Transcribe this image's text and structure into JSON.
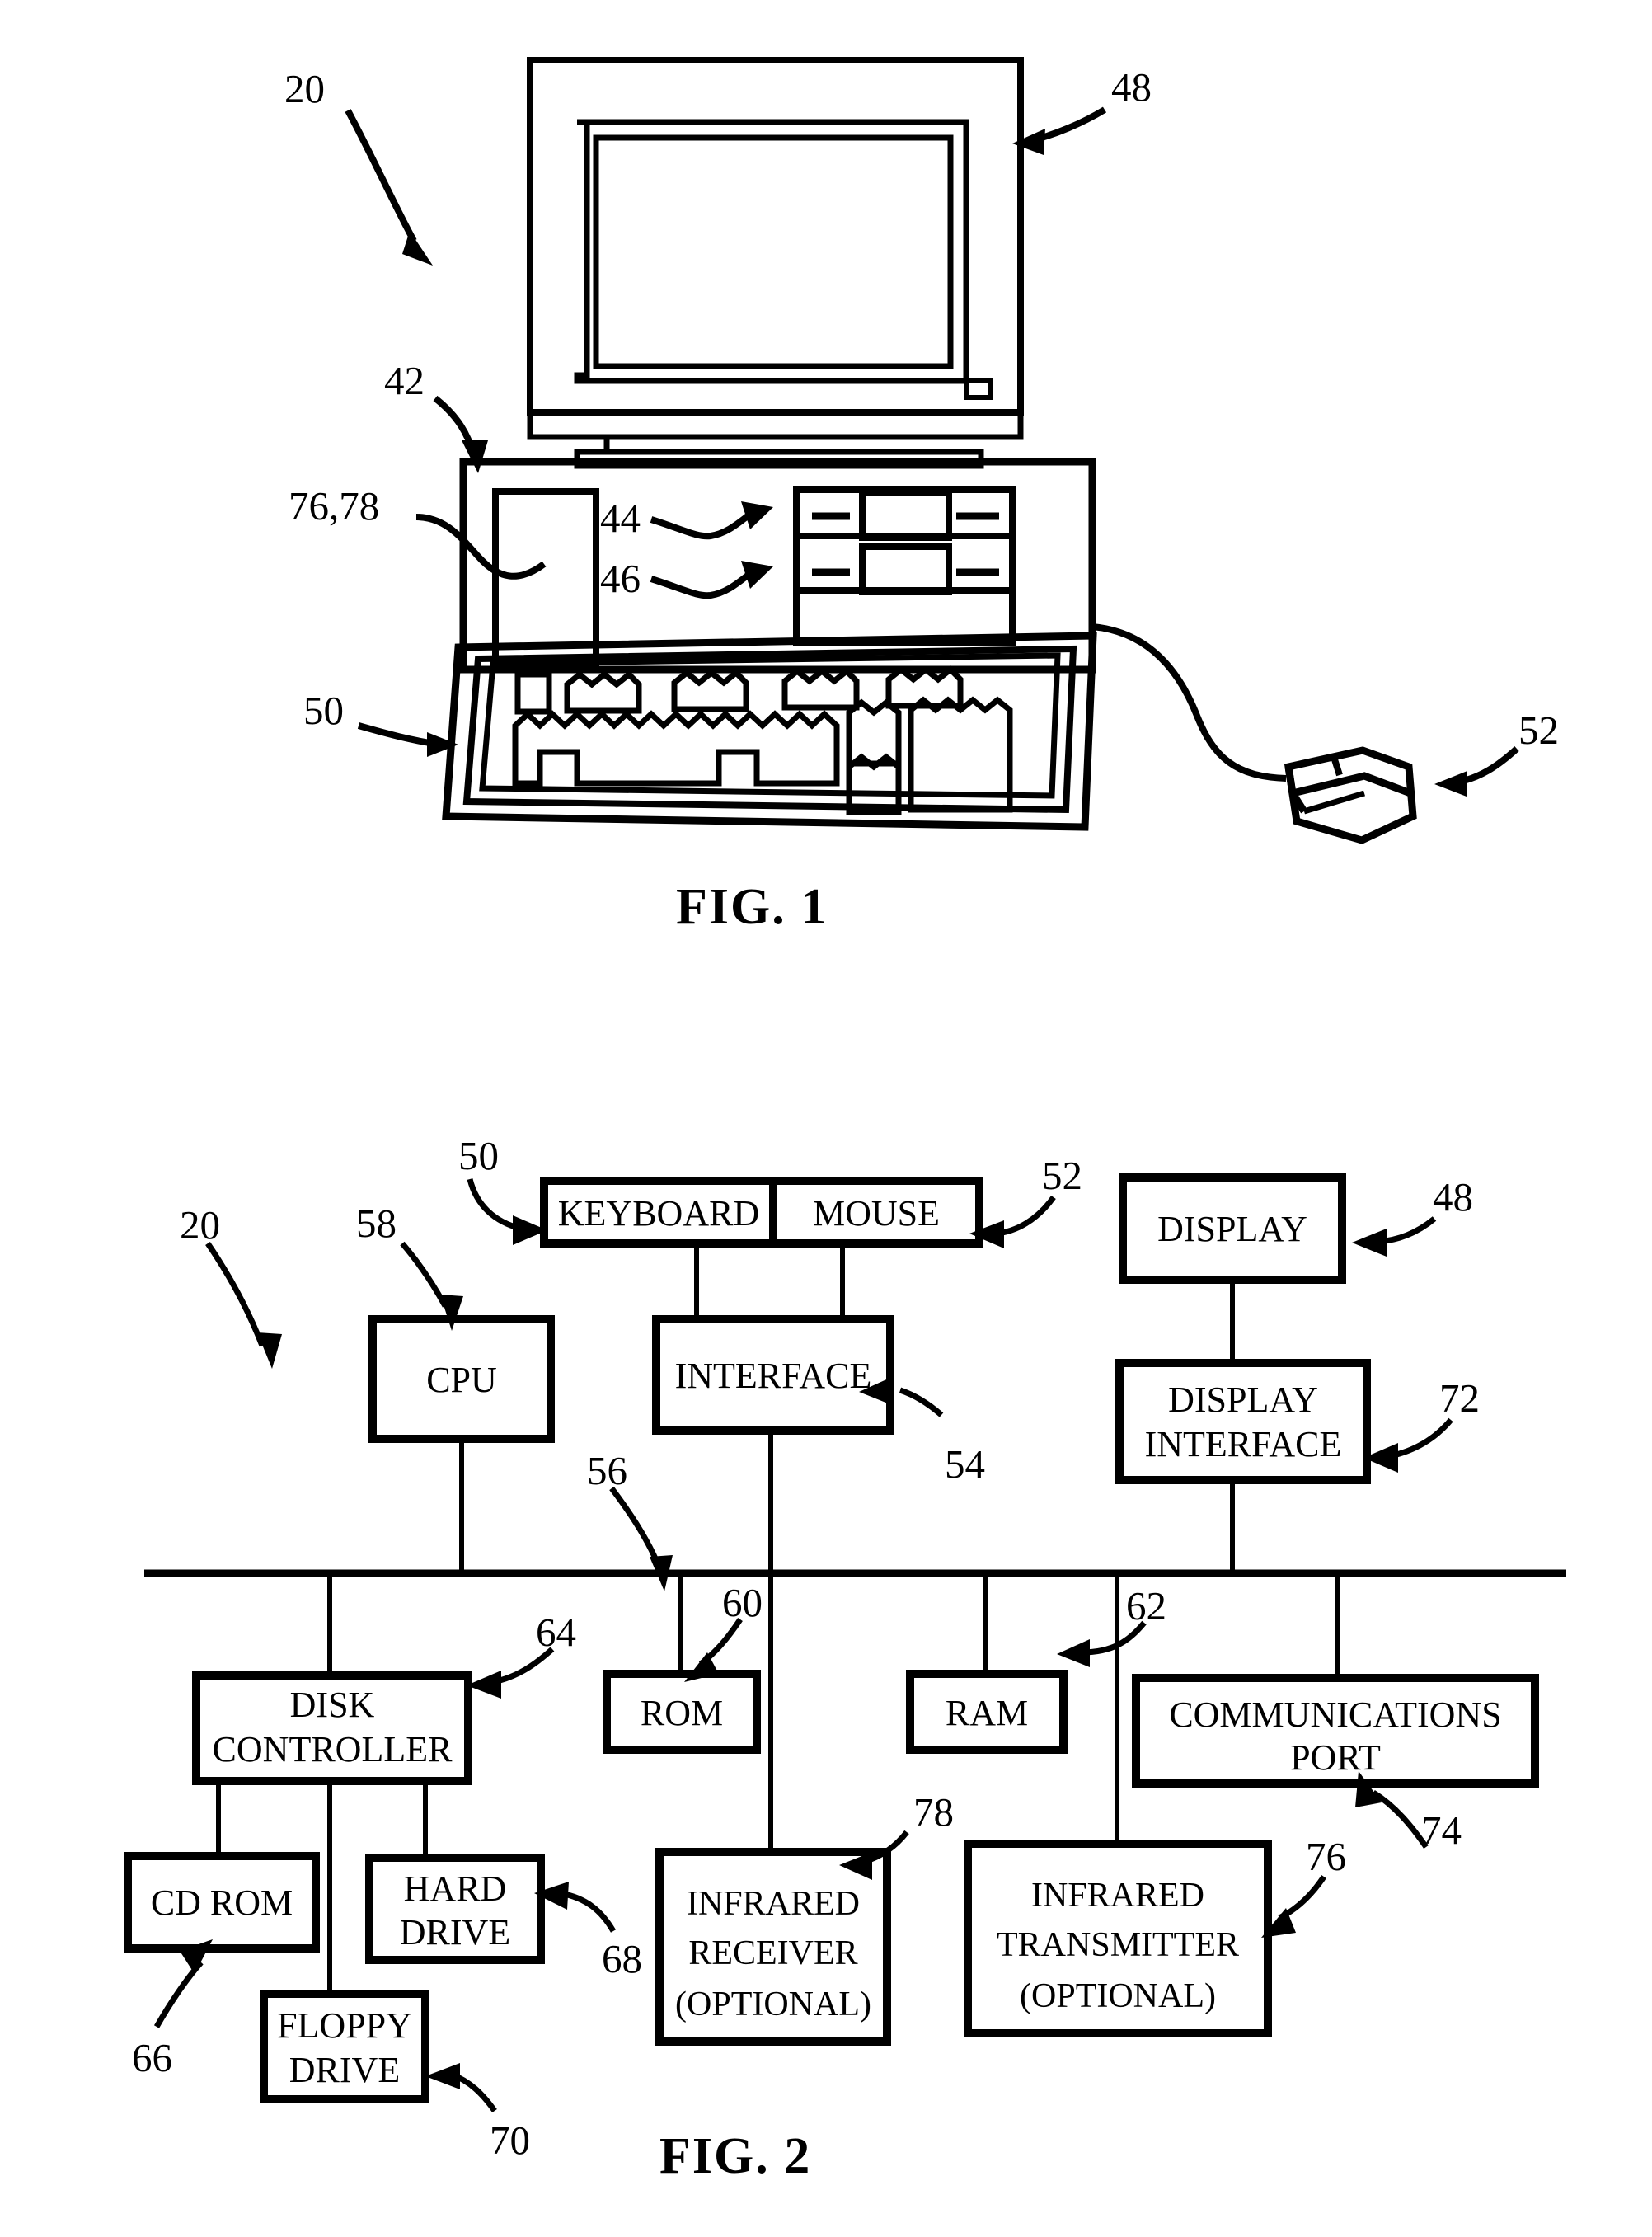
{
  "figure1": {
    "caption": "FIG. 1",
    "callouts": [
      {
        "id": "c20",
        "label": "20"
      },
      {
        "id": "c48",
        "label": "48"
      },
      {
        "id": "c42",
        "label": "42"
      },
      {
        "id": "c44",
        "label": "44"
      },
      {
        "id": "c46",
        "label": "46"
      },
      {
        "id": "c7678",
        "label": "76,78"
      },
      {
        "id": "c50",
        "label": "50"
      },
      {
        "id": "c52",
        "label": "52"
      }
    ],
    "parts": {
      "monitor": "display-monitor",
      "system_unit": "system-unit-chassis",
      "drive_bay_upper": "upper-drive-bay",
      "drive_bay_lower": "lower-drive-bay",
      "infrared_module": "infrared-module-panel",
      "keyboard": "keyboard",
      "mouse": "mouse",
      "mouse_cable": "mouse-cable"
    }
  },
  "figure2": {
    "caption": "FIG. 2",
    "callouts": [
      {
        "id": "c20",
        "label": "20"
      },
      {
        "id": "c50",
        "label": "50"
      },
      {
        "id": "c52",
        "label": "52"
      },
      {
        "id": "c48",
        "label": "48"
      },
      {
        "id": "c58",
        "label": "58"
      },
      {
        "id": "c54",
        "label": "54"
      },
      {
        "id": "c56",
        "label": "56"
      },
      {
        "id": "c72",
        "label": "72"
      },
      {
        "id": "c60",
        "label": "60"
      },
      {
        "id": "c62",
        "label": "62"
      },
      {
        "id": "c64",
        "label": "64"
      },
      {
        "id": "c66",
        "label": "66"
      },
      {
        "id": "c68",
        "label": "68"
      },
      {
        "id": "c70",
        "label": "70"
      },
      {
        "id": "c74",
        "label": "74"
      },
      {
        "id": "c76",
        "label": "76"
      },
      {
        "id": "c78",
        "label": "78"
      }
    ],
    "blocks": [
      {
        "id": "keyboard",
        "lines": [
          "KEYBOARD"
        ],
        "ref": "50"
      },
      {
        "id": "mouse",
        "lines": [
          "MOUSE"
        ],
        "ref": "52"
      },
      {
        "id": "display",
        "lines": [
          "DISPLAY"
        ],
        "ref": "48"
      },
      {
        "id": "cpu",
        "lines": [
          "CPU"
        ],
        "ref": "58"
      },
      {
        "id": "interface",
        "lines": [
          "INTERFACE"
        ],
        "ref": "54"
      },
      {
        "id": "display_if",
        "lines": [
          "DISPLAY",
          "INTERFACE"
        ],
        "ref": "72"
      },
      {
        "id": "disk_ctrl",
        "lines": [
          "DISK",
          "CONTROLLER"
        ],
        "ref": "64"
      },
      {
        "id": "rom",
        "lines": [
          "ROM"
        ],
        "ref": "60"
      },
      {
        "id": "ram",
        "lines": [
          "RAM"
        ],
        "ref": "62"
      },
      {
        "id": "comm_port",
        "lines": [
          "COMMUNICATIONS",
          "PORT"
        ],
        "ref": "74"
      },
      {
        "id": "cd_rom",
        "lines": [
          "CD ROM"
        ],
        "ref": "66"
      },
      {
        "id": "hard_drive",
        "lines": [
          "HARD",
          "DRIVE"
        ],
        "ref": "68"
      },
      {
        "id": "floppy",
        "lines": [
          "FLOPPY",
          "DRIVE"
        ],
        "ref": "70"
      },
      {
        "id": "ir_recv",
        "lines": [
          "INFRARED",
          "RECEIVER",
          "(OPTIONAL)"
        ],
        "ref": "78"
      },
      {
        "id": "ir_xmit",
        "lines": [
          "INFRARED",
          "TRANSMITTER",
          "(OPTIONAL)"
        ],
        "ref": "76"
      }
    ],
    "bus_label": "system-bus"
  },
  "style": {
    "ink": "#000000",
    "paper": "#ffffff"
  }
}
